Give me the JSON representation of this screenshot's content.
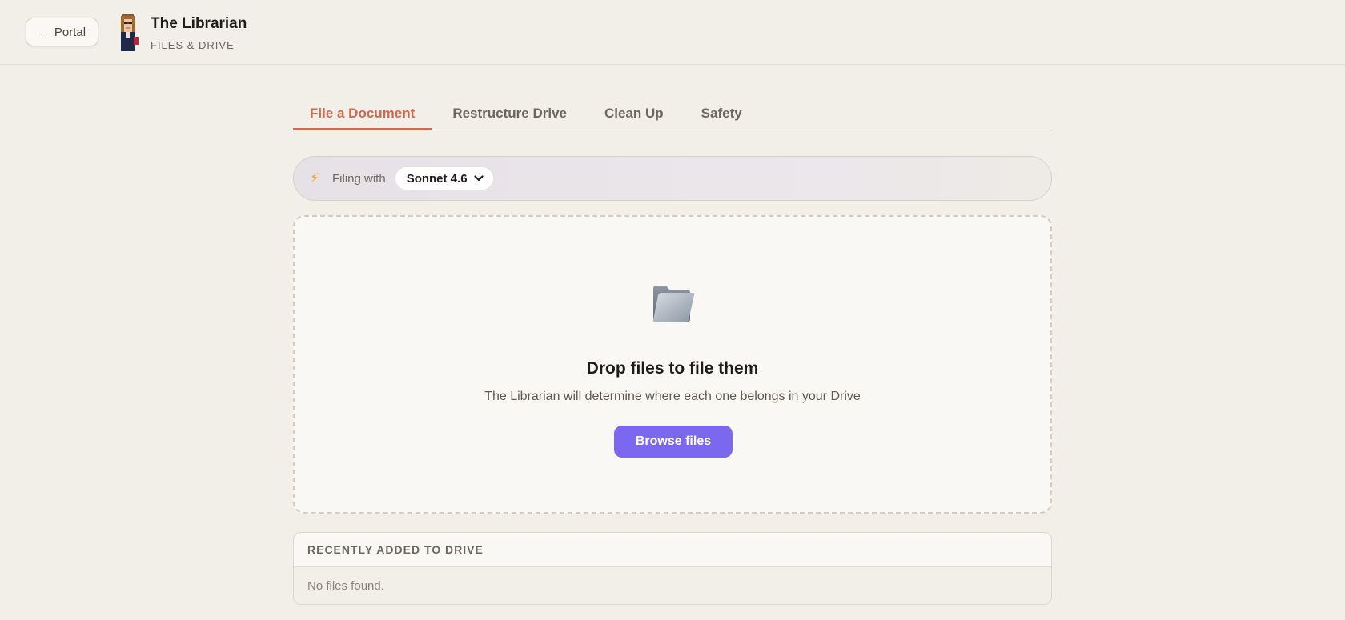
{
  "header": {
    "back_label": "Portal",
    "back_arrow": "←",
    "title": "The Librarian",
    "subtitle": "FILES & DRIVE"
  },
  "tabs": [
    {
      "label": "File a Document",
      "active": true
    },
    {
      "label": "Restructure Drive",
      "active": false
    },
    {
      "label": "Clean Up",
      "active": false
    },
    {
      "label": "Safety",
      "active": false
    }
  ],
  "model_bar": {
    "icon": "bolt-icon",
    "label": "Filing with",
    "selected_model": "Sonnet 4.6"
  },
  "drop_zone": {
    "icon": "folder-icon",
    "title": "Drop files to file them",
    "subtitle": "The Librarian will determine where each one belongs in your Drive",
    "button_label": "Browse files"
  },
  "recent": {
    "header": "RECENTLY ADDED TO DRIVE",
    "empty_text": "No files found."
  },
  "colors": {
    "accent": "#cf6a4d",
    "button": "#7b68ee",
    "background": "#f2efe9"
  }
}
